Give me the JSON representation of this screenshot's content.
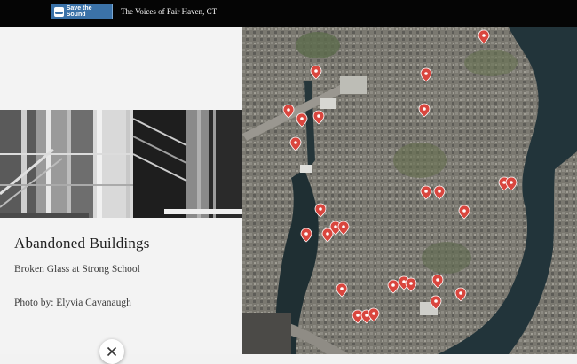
{
  "header": {
    "logo_text": "Save the Sound",
    "title": "The Voices of Fair Haven, CT"
  },
  "story": {
    "title": "Abandoned Buildings",
    "subtitle": "Broken Glass at Strong School",
    "credit": "Photo by: Elyvia Cavanaugh"
  },
  "controls": {
    "close_icon": "close-icon"
  },
  "map": {
    "marker_color": "#d9463e",
    "water_color": "#22343a",
    "markers_count_note": ""
  },
  "colors": {
    "header_bg": "#050505",
    "panel_bg": "#f3f3f3",
    "accent": "#3b72a8"
  }
}
